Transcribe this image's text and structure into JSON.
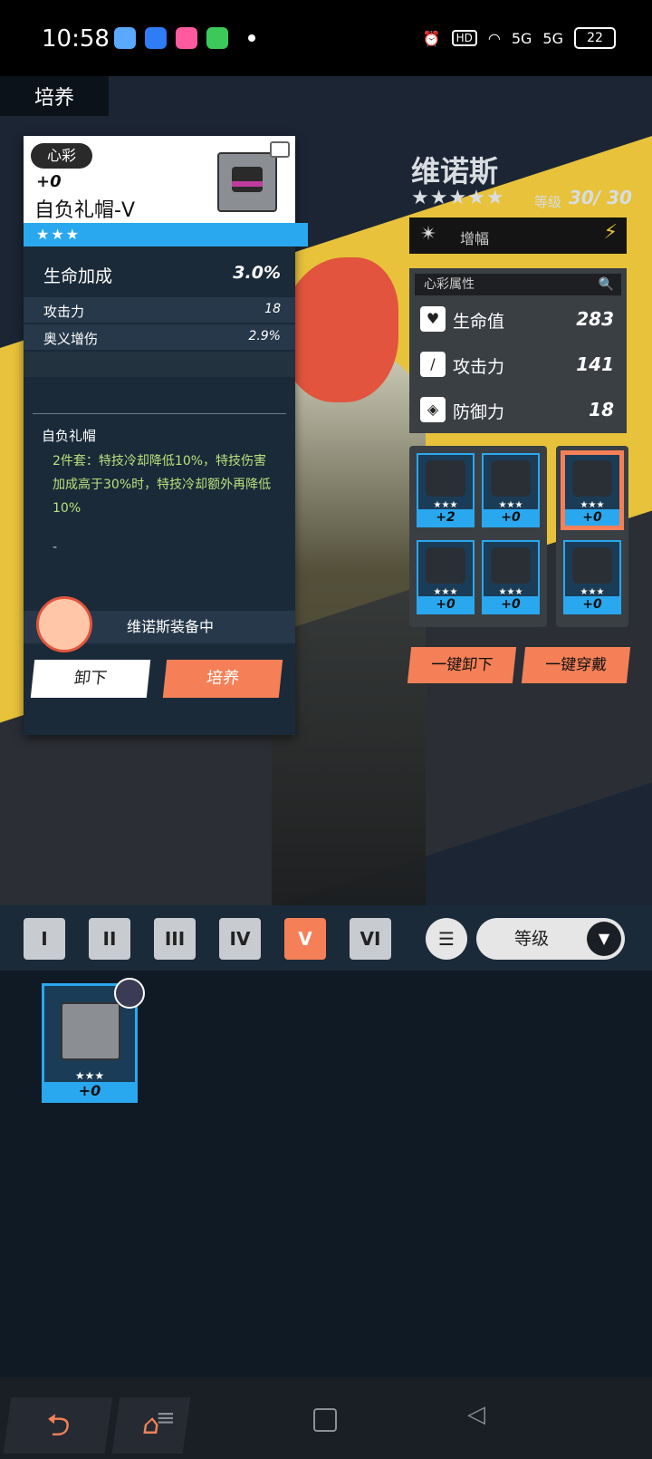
{
  "status_bar": {
    "time": "10:58",
    "hd": "HD",
    "network1": "5G",
    "network2": "5G",
    "battery": "22"
  },
  "header": {
    "title": "培养"
  },
  "disk_card": {
    "tag": "心彩",
    "level": "+0",
    "name": "自负礼帽-V",
    "rarity": "★★★",
    "main_stat": {
      "label": "生命加成",
      "value": "3.0%"
    },
    "sub_stats": [
      {
        "label": "攻击力",
        "value": "18"
      },
      {
        "label": "奥义增伤",
        "value": "2.9%"
      }
    ],
    "set_name": "自负礼帽",
    "set_desc": "2件套：特技冷却降低10%，特技伤害加成高于30%时，特技冷却额外再降低10%",
    "dash": "-",
    "equipped_by": "维诺斯装备中",
    "btn_unequip": "卸下",
    "btn_train": "培养"
  },
  "character": {
    "name": "维诺斯",
    "stars": "★★★★★",
    "level_label": "等级",
    "level_value": "30/ 30",
    "w_engine_label": "增幅"
  },
  "attr_panel": {
    "title": "心彩属性",
    "rows": [
      {
        "icon": "heart-icon",
        "label": "生命值",
        "value": "283"
      },
      {
        "icon": "sword-icon",
        "label": "攻击力",
        "value": "141"
      },
      {
        "icon": "shield-icon",
        "label": "防御力",
        "value": "18"
      }
    ]
  },
  "equipped_disks": [
    {
      "stars": "★★★",
      "plus": "+2"
    },
    {
      "stars": "★★★",
      "plus": "+0"
    },
    {
      "stars": "★★★",
      "plus": "+0"
    },
    {
      "stars": "★★★",
      "plus": "+0"
    },
    {
      "stars": "★★★",
      "plus": "+0",
      "selected": true
    },
    {
      "stars": "★★★",
      "plus": "+0"
    }
  ],
  "actions": {
    "unequip_all": "一键卸下",
    "equip_all": "一键穿戴"
  },
  "filter": {
    "slots": [
      "I",
      "II",
      "III",
      "IV",
      "V",
      "VI"
    ],
    "active_slot": "V",
    "sort_label": "等级"
  },
  "inventory": [
    {
      "stars": "★★★",
      "plus": "+0"
    }
  ],
  "colors": {
    "accent": "#f58057",
    "blue": "#2aa8ef",
    "yellow": "#e7c23a"
  }
}
